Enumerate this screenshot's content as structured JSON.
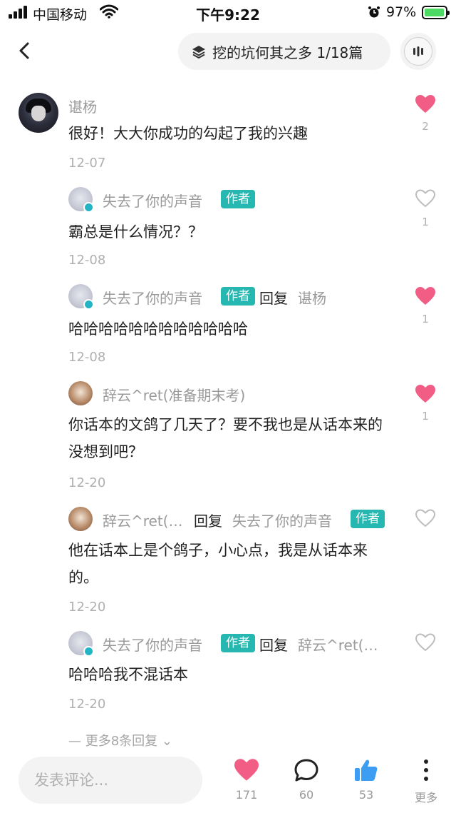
{
  "status_bar": {
    "carrier": "中国移动",
    "time": "下午9:22",
    "battery_pct": "97%"
  },
  "header": {
    "title": "挖的坑何其之多 1/18篇"
  },
  "comments": [
    {
      "user": "谌杨",
      "text": "很好！大大你成功的勾起了我的兴趣",
      "date": "12-07",
      "likes": "2",
      "liked": true
    },
    {
      "user": "失去了你的声音",
      "tag": "作者",
      "text": "霸总是什么情况？？",
      "date": "12-08",
      "likes": "1",
      "liked": false
    },
    {
      "user": "失去了你的声音",
      "tag": "作者",
      "reply": "回复",
      "reply_to": "谌杨",
      "text": "哈哈哈哈哈哈哈哈哈哈哈哈",
      "date": "12-08",
      "likes": "1",
      "liked": true
    },
    {
      "user": "辞云^ret(准备期末考)",
      "text": "你话本的文鸽了几天了？要不我也是从话本来的没想到吧？",
      "date": "12-20",
      "likes": "1",
      "liked": true
    },
    {
      "user": "辞云^ret(…",
      "reply": "回复",
      "reply_to": "失去了你的声音",
      "reply_to_tag": "作者",
      "text": "他在话本上是个鸽子，小心点，我是从话本来的。",
      "date": "12-20",
      "likes": "",
      "liked": false
    },
    {
      "user": "失去了你的声音",
      "tag": "作者",
      "reply": "回复",
      "reply_to": "辞云^ret(…",
      "text": "哈哈哈我不混话本",
      "date": "12-20",
      "likes": "",
      "liked": false
    }
  ],
  "more_replies": "— 更多8条回复 ⌄",
  "bottom_bar": {
    "input_placeholder": "发表评论...",
    "likes": "171",
    "comments": "60",
    "thumbs": "53",
    "more_label": "更多"
  },
  "colors": {
    "like_active": "#f25d86",
    "author_tag": "#26b8b0",
    "thumb": "#3d9df2"
  }
}
